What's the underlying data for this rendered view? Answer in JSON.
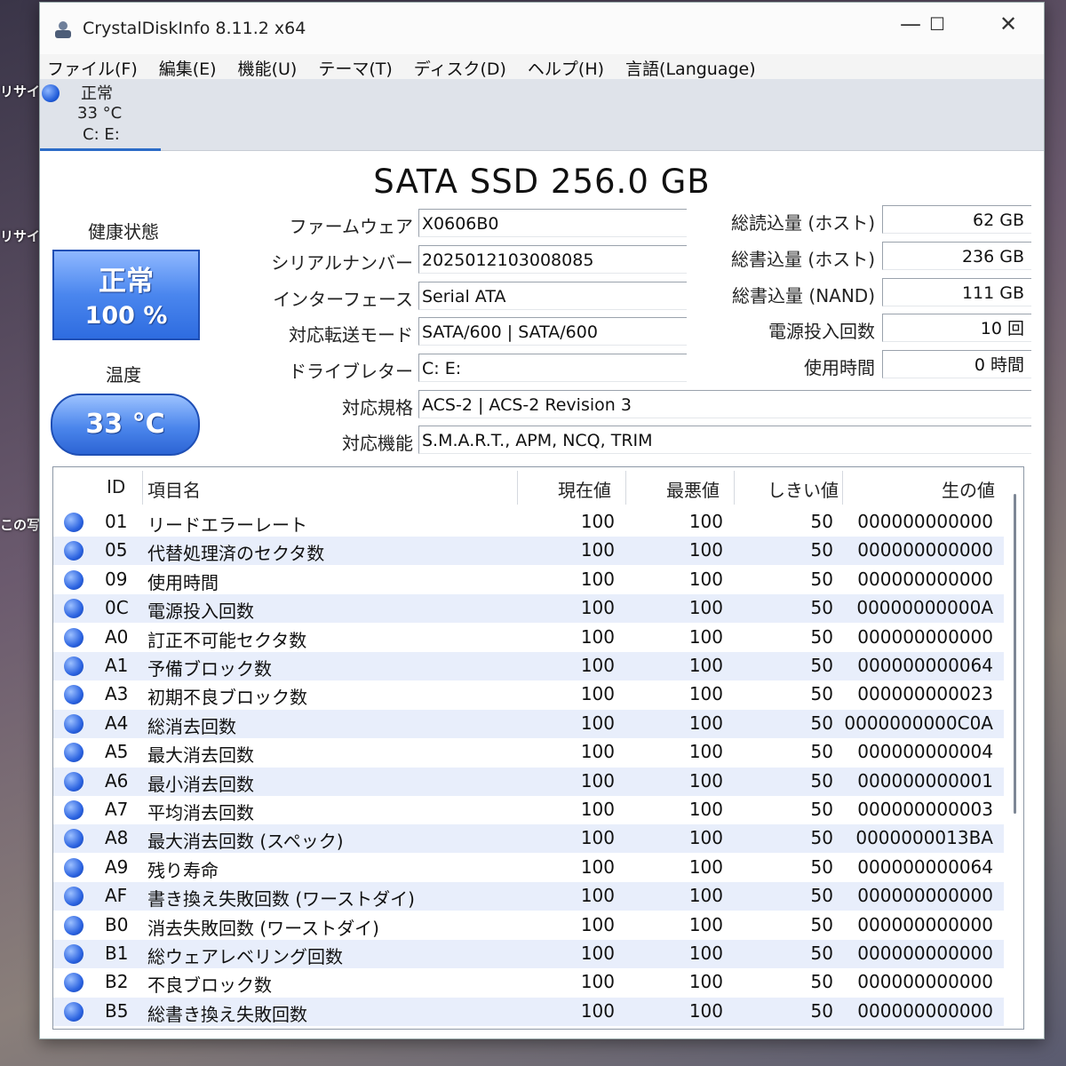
{
  "desktop": {
    "labels": [
      "リサイ",
      "リサイ",
      "この写"
    ]
  },
  "window": {
    "title": "CrystalDiskInfo 8.11.2 x64",
    "controls": {
      "minimize": "—",
      "maximize": "☐",
      "close": "✕"
    }
  },
  "menu": [
    "ファイル(F)",
    "編集(E)",
    "機能(U)",
    "テーマ(T)",
    "ディスク(D)",
    "ヘルプ(H)",
    "言語(Language)"
  ],
  "drive_tab": {
    "status": "正常",
    "temp": "33 °C",
    "letters": "C: E:"
  },
  "model": "SATA SSD 256.0 GB",
  "health": {
    "label": "健康状態",
    "status": "正常",
    "percent": "100 %"
  },
  "temperature": {
    "label": "温度",
    "value": "33 °C"
  },
  "info_left": [
    {
      "label": "ファームウェア",
      "value": "X0606B0"
    },
    {
      "label": "シリアルナンバー",
      "value": "2025012103008085"
    },
    {
      "label": "インターフェース",
      "value": "Serial ATA"
    },
    {
      "label": "対応転送モード",
      "value": "SATA/600 | SATA/600"
    },
    {
      "label": "ドライブレター",
      "value": "C: E:"
    }
  ],
  "info_wide": [
    {
      "label": "対応規格",
      "value": "ACS-2 | ACS-2 Revision 3"
    },
    {
      "label": "対応機能",
      "value": "S.M.A.R.T., APM, NCQ, TRIM"
    }
  ],
  "info_right": [
    {
      "label": "総読込量 (ホスト)",
      "value": "62 GB"
    },
    {
      "label": "総書込量 (ホスト)",
      "value": "236 GB"
    },
    {
      "label": "総書込量 (NAND)",
      "value": "111 GB"
    },
    {
      "label": "電源投入回数",
      "value": "10 回"
    },
    {
      "label": "使用時間",
      "value": "0 時間"
    }
  ],
  "smart": {
    "headers": {
      "id": "ID",
      "name": "項目名",
      "current": "現在値",
      "worst": "最悪値",
      "threshold": "しきい値",
      "raw": "生の値"
    },
    "rows": [
      {
        "id": "01",
        "name": "リードエラーレート",
        "current": "100",
        "worst": "100",
        "threshold": "50",
        "raw": "000000000000"
      },
      {
        "id": "05",
        "name": "代替処理済のセクタ数",
        "current": "100",
        "worst": "100",
        "threshold": "50",
        "raw": "000000000000"
      },
      {
        "id": "09",
        "name": "使用時間",
        "current": "100",
        "worst": "100",
        "threshold": "50",
        "raw": "000000000000"
      },
      {
        "id": "0C",
        "name": "電源投入回数",
        "current": "100",
        "worst": "100",
        "threshold": "50",
        "raw": "00000000000A"
      },
      {
        "id": "A0",
        "name": "訂正不可能セクタ数",
        "current": "100",
        "worst": "100",
        "threshold": "50",
        "raw": "000000000000"
      },
      {
        "id": "A1",
        "name": "予備ブロック数",
        "current": "100",
        "worst": "100",
        "threshold": "50",
        "raw": "000000000064"
      },
      {
        "id": "A3",
        "name": "初期不良ブロック数",
        "current": "100",
        "worst": "100",
        "threshold": "50",
        "raw": "000000000023"
      },
      {
        "id": "A4",
        "name": "総消去回数",
        "current": "100",
        "worst": "100",
        "threshold": "50",
        "raw": "0000000000C0A"
      },
      {
        "id": "A5",
        "name": "最大消去回数",
        "current": "100",
        "worst": "100",
        "threshold": "50",
        "raw": "000000000004"
      },
      {
        "id": "A6",
        "name": "最小消去回数",
        "current": "100",
        "worst": "100",
        "threshold": "50",
        "raw": "000000000001"
      },
      {
        "id": "A7",
        "name": "平均消去回数",
        "current": "100",
        "worst": "100",
        "threshold": "50",
        "raw": "000000000003"
      },
      {
        "id": "A8",
        "name": "最大消去回数 (スペック)",
        "current": "100",
        "worst": "100",
        "threshold": "50",
        "raw": "0000000013BA"
      },
      {
        "id": "A9",
        "name": "残り寿命",
        "current": "100",
        "worst": "100",
        "threshold": "50",
        "raw": "000000000064"
      },
      {
        "id": "AF",
        "name": "書き換え失敗回数 (ワーストダイ)",
        "current": "100",
        "worst": "100",
        "threshold": "50",
        "raw": "000000000000"
      },
      {
        "id": "B0",
        "name": "消去失敗回数 (ワーストダイ)",
        "current": "100",
        "worst": "100",
        "threshold": "50",
        "raw": "000000000000"
      },
      {
        "id": "B1",
        "name": "総ウェアレベリング回数",
        "current": "100",
        "worst": "100",
        "threshold": "50",
        "raw": "000000000000"
      },
      {
        "id": "B2",
        "name": "不良ブロック数",
        "current": "100",
        "worst": "100",
        "threshold": "50",
        "raw": "000000000000"
      },
      {
        "id": "B5",
        "name": "総書き換え失敗回数",
        "current": "100",
        "worst": "100",
        "threshold": "50",
        "raw": "000000000000"
      }
    ]
  }
}
